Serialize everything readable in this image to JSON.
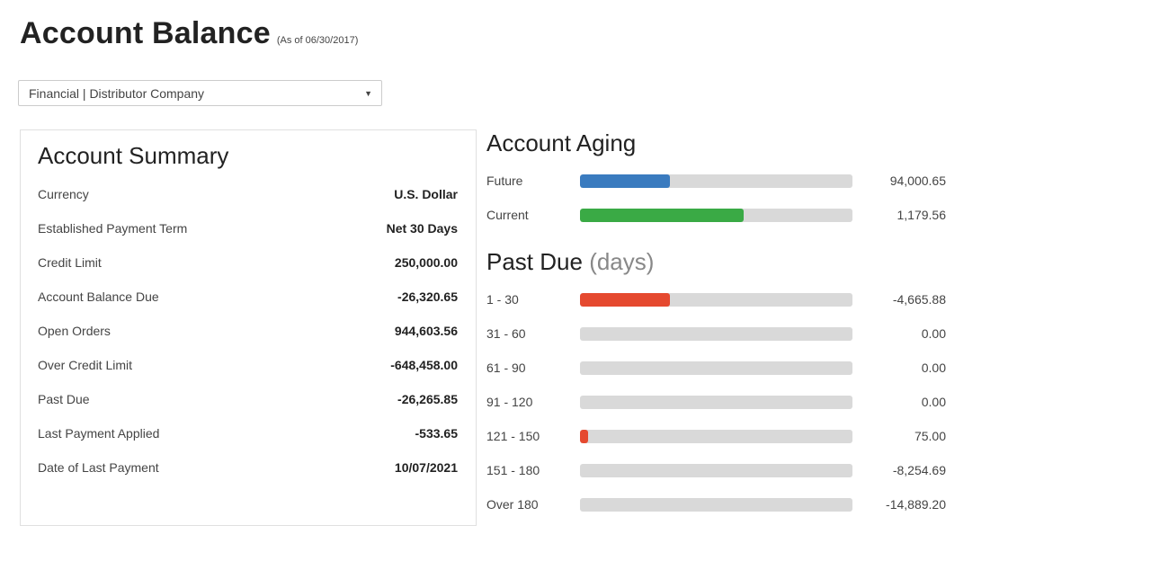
{
  "header": {
    "title": "Account Balance",
    "as_of": "(As of 06/30/2017)"
  },
  "company_select": {
    "value": "Financial | Distributor Company"
  },
  "summary": {
    "title": "Account Summary",
    "rows": [
      {
        "label": "Currency",
        "value": "U.S. Dollar"
      },
      {
        "label": "Established Payment Term",
        "value": "Net 30 Days"
      },
      {
        "label": "Credit Limit",
        "value": "250,000.00"
      },
      {
        "label": "Account Balance Due",
        "value": "-26,320.65"
      },
      {
        "label": "Open Orders",
        "value": "944,603.56"
      },
      {
        "label": "Over Credit Limit",
        "value": "-648,458.00"
      },
      {
        "label": "Past Due",
        "value": "-26,265.85"
      },
      {
        "label": "Last Payment Applied",
        "value": "-533.65"
      },
      {
        "label": "Date of Last Payment",
        "value": "10/07/2021"
      }
    ]
  },
  "aging": {
    "title": "Account Aging",
    "rows": [
      {
        "label": "Future",
        "value": "94,000.65",
        "fill_pct": 33,
        "color": "#3a7bbf"
      },
      {
        "label": "Current",
        "value": "1,179.56",
        "fill_pct": 60,
        "color": "#3aaa45"
      }
    ]
  },
  "past_due": {
    "title": "Past Due",
    "title_suffix": "(days)",
    "rows": [
      {
        "label": "1 - 30",
        "value": "-4,665.88",
        "fill_pct": 33,
        "color": "#e5492f"
      },
      {
        "label": "31 - 60",
        "value": "0.00",
        "fill_pct": 0,
        "color": "#e5492f"
      },
      {
        "label": "61 - 90",
        "value": "0.00",
        "fill_pct": 0,
        "color": "#e5492f"
      },
      {
        "label": "91 - 120",
        "value": "0.00",
        "fill_pct": 0,
        "color": "#e5492f"
      },
      {
        "label": "121 - 150",
        "value": "75.00",
        "fill_pct": 3,
        "color": "#e5492f"
      },
      {
        "label": "151 - 180",
        "value": "-8,254.69",
        "fill_pct": 0,
        "color": "#e5492f"
      },
      {
        "label": "Over 180",
        "value": "-14,889.20",
        "fill_pct": 0,
        "color": "#e5492f"
      }
    ]
  }
}
